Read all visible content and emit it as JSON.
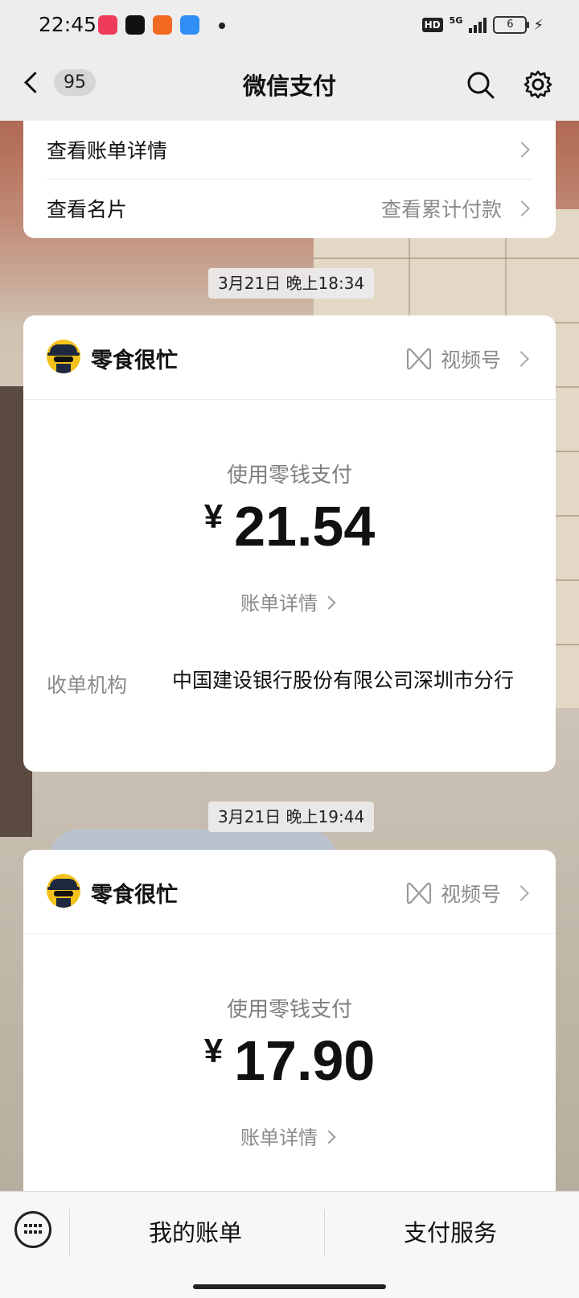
{
  "status_bar": {
    "time": "22:45",
    "network": "5G",
    "hd_label": "HD",
    "battery_level": "6",
    "apps": [
      {
        "icon": "music-app-icon",
        "color": "#f03c5a"
      },
      {
        "icon": "tiktok-icon",
        "color": "#111111"
      },
      {
        "icon": "kuaishou-icon",
        "color": "#f26a21"
      },
      {
        "icon": "messages-app-icon",
        "color": "#2f8ff5"
      }
    ]
  },
  "nav": {
    "unread_count": "95",
    "title": "微信支付"
  },
  "top_card": {
    "bill_detail": "查看账单详情",
    "view_card": "查看名片",
    "view_total": "查看累计付款"
  },
  "payments": [
    {
      "timestamp": "3月21日 晚上18:34",
      "merchant": "零食很忙",
      "channel": "视频号",
      "pay_label": "使用零钱支付",
      "currency": "¥",
      "amount": "21.54",
      "bill_link": "账单详情",
      "acquirer_label": "收单机构",
      "acquirer": "中国建设银行股份有限公司深圳市分行"
    },
    {
      "timestamp": "3月21日 晚上19:44",
      "merchant": "零食很忙",
      "channel": "视频号",
      "pay_label": "使用零钱支付",
      "currency": "¥",
      "amount": "17.90",
      "bill_link": "账单详情"
    }
  ],
  "bottom_bar": {
    "my_bills": "我的账单",
    "pay_services": "支付服务"
  },
  "colors": {
    "nav_bg": "#ededed",
    "card_bg": "#ffffff",
    "secondary_text": "#8a8a8a"
  }
}
